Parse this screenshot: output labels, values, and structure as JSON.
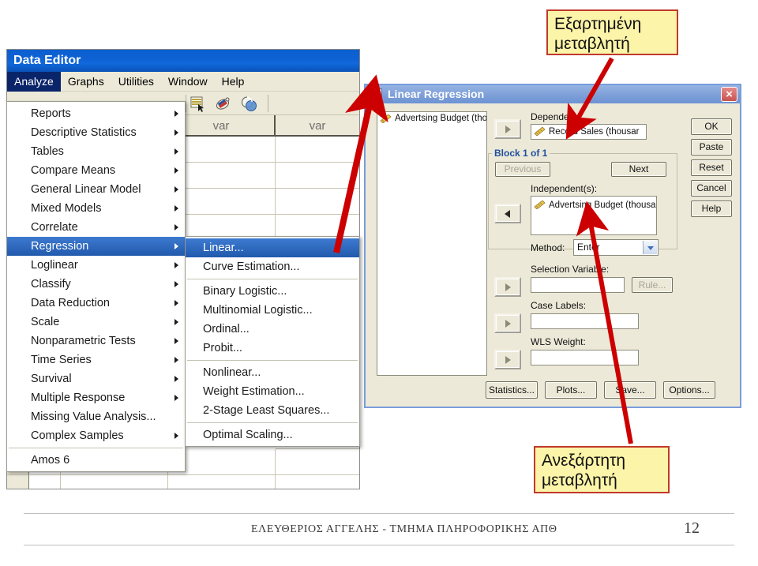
{
  "slide": {
    "page_number": "12",
    "footer_text": "ΕΛΕΥΘΕΡΙΟΣ ΑΓΓΕΛΗΣ - ΤΜΗΜΑ ΠΛΗΡΟΦΟΡΙΚΗΣ ΑΠΘ"
  },
  "callouts": {
    "dependent": "Εξαρτημένη\nμεταβλητή",
    "independent": "Ανεξάρτητη\nμεταβλητή",
    "box_fill": "#FCF4A8",
    "box_border": "#C0392B",
    "arrow_color": "#CC0000"
  },
  "data_editor": {
    "title": "Data Editor",
    "menubar": [
      {
        "label": "Analyze",
        "active": true
      },
      {
        "label": "Graphs",
        "active": false
      },
      {
        "label": "Utilities",
        "active": false
      },
      {
        "label": "Window",
        "active": false
      },
      {
        "label": "Help",
        "active": false
      }
    ],
    "grid": {
      "column_headers": [
        "var",
        "var",
        "var"
      ]
    },
    "title_bar_color": "#0B5FD2"
  },
  "analyze_menu": {
    "items": [
      {
        "label": "Reports",
        "submenu": true,
        "selected": false
      },
      {
        "label": "Descriptive Statistics",
        "submenu": true,
        "selected": false
      },
      {
        "label": "Tables",
        "submenu": true,
        "selected": false
      },
      {
        "label": "Compare Means",
        "submenu": true,
        "selected": false
      },
      {
        "label": "General Linear Model",
        "submenu": true,
        "selected": false
      },
      {
        "label": "Mixed Models",
        "submenu": true,
        "selected": false
      },
      {
        "label": "Correlate",
        "submenu": true,
        "selected": false
      },
      {
        "label": "Regression",
        "submenu": true,
        "selected": true
      },
      {
        "label": "Loglinear",
        "submenu": true,
        "selected": false
      },
      {
        "label": "Classify",
        "submenu": true,
        "selected": false
      },
      {
        "label": "Data Reduction",
        "submenu": true,
        "selected": false
      },
      {
        "label": "Scale",
        "submenu": true,
        "selected": false
      },
      {
        "label": "Nonparametric Tests",
        "submenu": true,
        "selected": false
      },
      {
        "label": "Time Series",
        "submenu": true,
        "selected": false
      },
      {
        "label": "Survival",
        "submenu": true,
        "selected": false
      },
      {
        "label": "Multiple Response",
        "submenu": true,
        "selected": false
      },
      {
        "label": "Missing Value Analysis...",
        "submenu": false,
        "selected": false
      },
      {
        "label": "Complex Samples",
        "submenu": true,
        "selected": false
      },
      {
        "separator": true
      },
      {
        "label": "Amos 6",
        "submenu": false,
        "selected": false
      }
    ]
  },
  "regression_submenu": {
    "items": [
      {
        "label": "Linear...",
        "selected": true
      },
      {
        "label": "Curve Estimation...",
        "selected": false
      },
      {
        "separator": true
      },
      {
        "label": "Binary Logistic...",
        "selected": false
      },
      {
        "label": "Multinomial Logistic...",
        "selected": false
      },
      {
        "label": "Ordinal...",
        "selected": false
      },
      {
        "label": "Probit...",
        "selected": false
      },
      {
        "separator": true
      },
      {
        "label": "Nonlinear...",
        "selected": false
      },
      {
        "label": "Weight Estimation...",
        "selected": false
      },
      {
        "label": "2-Stage Least Squares...",
        "selected": false
      },
      {
        "separator": true
      },
      {
        "label": "Optimal Scaling...",
        "selected": false
      }
    ]
  },
  "linear_regression_dialog": {
    "title": "Linear Regression",
    "source_variables": [
      "Advertsing Budget (tho"
    ],
    "dependent": {
      "label": "Dependent:",
      "value": "Record Sales (thousar"
    },
    "block": {
      "caption": "Block 1 of 1",
      "previous_button": "Previous",
      "next_button": "Next",
      "independents_label": "Independent(s):",
      "independents": [
        "Advertsing Budget (thousan"
      ],
      "method_label": "Method:",
      "method_value": "Enter"
    },
    "selection_variable": {
      "label": "Selection Variable:",
      "value": "",
      "rule_button": "Rule..."
    },
    "case_labels": {
      "label": "Case Labels:",
      "value": ""
    },
    "wls_weight": {
      "label": "WLS Weight:",
      "value": ""
    },
    "bottom_buttons": [
      "Statistics...",
      "Plots...",
      "Save...",
      "Options..."
    ],
    "side_buttons": [
      "OK",
      "Paste",
      "Reset",
      "Cancel",
      "Help"
    ],
    "close_icon": "×",
    "title_bar_color": "#7FA0D8"
  }
}
